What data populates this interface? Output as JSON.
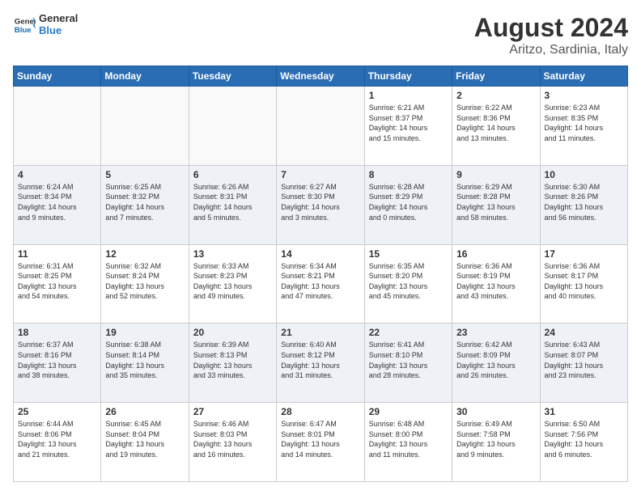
{
  "header": {
    "logo_general": "General",
    "logo_blue": "Blue",
    "main_title": "August 2024",
    "sub_title": "Aritzo, Sardinia, Italy"
  },
  "columns": [
    "Sunday",
    "Monday",
    "Tuesday",
    "Wednesday",
    "Thursday",
    "Friday",
    "Saturday"
  ],
  "weeks": [
    {
      "days": [
        {
          "num": "",
          "info": ""
        },
        {
          "num": "",
          "info": ""
        },
        {
          "num": "",
          "info": ""
        },
        {
          "num": "",
          "info": ""
        },
        {
          "num": "1",
          "info": "Sunrise: 6:21 AM\nSunset: 8:37 PM\nDaylight: 14 hours\nand 15 minutes."
        },
        {
          "num": "2",
          "info": "Sunrise: 6:22 AM\nSunset: 8:36 PM\nDaylight: 14 hours\nand 13 minutes."
        },
        {
          "num": "3",
          "info": "Sunrise: 6:23 AM\nSunset: 8:35 PM\nDaylight: 14 hours\nand 11 minutes."
        }
      ]
    },
    {
      "days": [
        {
          "num": "4",
          "info": "Sunrise: 6:24 AM\nSunset: 8:34 PM\nDaylight: 14 hours\nand 9 minutes."
        },
        {
          "num": "5",
          "info": "Sunrise: 6:25 AM\nSunset: 8:32 PM\nDaylight: 14 hours\nand 7 minutes."
        },
        {
          "num": "6",
          "info": "Sunrise: 6:26 AM\nSunset: 8:31 PM\nDaylight: 14 hours\nand 5 minutes."
        },
        {
          "num": "7",
          "info": "Sunrise: 6:27 AM\nSunset: 8:30 PM\nDaylight: 14 hours\nand 3 minutes."
        },
        {
          "num": "8",
          "info": "Sunrise: 6:28 AM\nSunset: 8:29 PM\nDaylight: 14 hours\nand 0 minutes."
        },
        {
          "num": "9",
          "info": "Sunrise: 6:29 AM\nSunset: 8:28 PM\nDaylight: 13 hours\nand 58 minutes."
        },
        {
          "num": "10",
          "info": "Sunrise: 6:30 AM\nSunset: 8:26 PM\nDaylight: 13 hours\nand 56 minutes."
        }
      ]
    },
    {
      "days": [
        {
          "num": "11",
          "info": "Sunrise: 6:31 AM\nSunset: 8:25 PM\nDaylight: 13 hours\nand 54 minutes."
        },
        {
          "num": "12",
          "info": "Sunrise: 6:32 AM\nSunset: 8:24 PM\nDaylight: 13 hours\nand 52 minutes."
        },
        {
          "num": "13",
          "info": "Sunrise: 6:33 AM\nSunset: 8:23 PM\nDaylight: 13 hours\nand 49 minutes."
        },
        {
          "num": "14",
          "info": "Sunrise: 6:34 AM\nSunset: 8:21 PM\nDaylight: 13 hours\nand 47 minutes."
        },
        {
          "num": "15",
          "info": "Sunrise: 6:35 AM\nSunset: 8:20 PM\nDaylight: 13 hours\nand 45 minutes."
        },
        {
          "num": "16",
          "info": "Sunrise: 6:36 AM\nSunset: 8:19 PM\nDaylight: 13 hours\nand 43 minutes."
        },
        {
          "num": "17",
          "info": "Sunrise: 6:36 AM\nSunset: 8:17 PM\nDaylight: 13 hours\nand 40 minutes."
        }
      ]
    },
    {
      "days": [
        {
          "num": "18",
          "info": "Sunrise: 6:37 AM\nSunset: 8:16 PM\nDaylight: 13 hours\nand 38 minutes."
        },
        {
          "num": "19",
          "info": "Sunrise: 6:38 AM\nSunset: 8:14 PM\nDaylight: 13 hours\nand 35 minutes."
        },
        {
          "num": "20",
          "info": "Sunrise: 6:39 AM\nSunset: 8:13 PM\nDaylight: 13 hours\nand 33 minutes."
        },
        {
          "num": "21",
          "info": "Sunrise: 6:40 AM\nSunset: 8:12 PM\nDaylight: 13 hours\nand 31 minutes."
        },
        {
          "num": "22",
          "info": "Sunrise: 6:41 AM\nSunset: 8:10 PM\nDaylight: 13 hours\nand 28 minutes."
        },
        {
          "num": "23",
          "info": "Sunrise: 6:42 AM\nSunset: 8:09 PM\nDaylight: 13 hours\nand 26 minutes."
        },
        {
          "num": "24",
          "info": "Sunrise: 6:43 AM\nSunset: 8:07 PM\nDaylight: 13 hours\nand 23 minutes."
        }
      ]
    },
    {
      "days": [
        {
          "num": "25",
          "info": "Sunrise: 6:44 AM\nSunset: 8:06 PM\nDaylight: 13 hours\nand 21 minutes."
        },
        {
          "num": "26",
          "info": "Sunrise: 6:45 AM\nSunset: 8:04 PM\nDaylight: 13 hours\nand 19 minutes."
        },
        {
          "num": "27",
          "info": "Sunrise: 6:46 AM\nSunset: 8:03 PM\nDaylight: 13 hours\nand 16 minutes."
        },
        {
          "num": "28",
          "info": "Sunrise: 6:47 AM\nSunset: 8:01 PM\nDaylight: 13 hours\nand 14 minutes."
        },
        {
          "num": "29",
          "info": "Sunrise: 6:48 AM\nSunset: 8:00 PM\nDaylight: 13 hours\nand 11 minutes."
        },
        {
          "num": "30",
          "info": "Sunrise: 6:49 AM\nSunset: 7:58 PM\nDaylight: 13 hours\nand 9 minutes."
        },
        {
          "num": "31",
          "info": "Sunrise: 6:50 AM\nSunset: 7:56 PM\nDaylight: 13 hours\nand 6 minutes."
        }
      ]
    }
  ]
}
